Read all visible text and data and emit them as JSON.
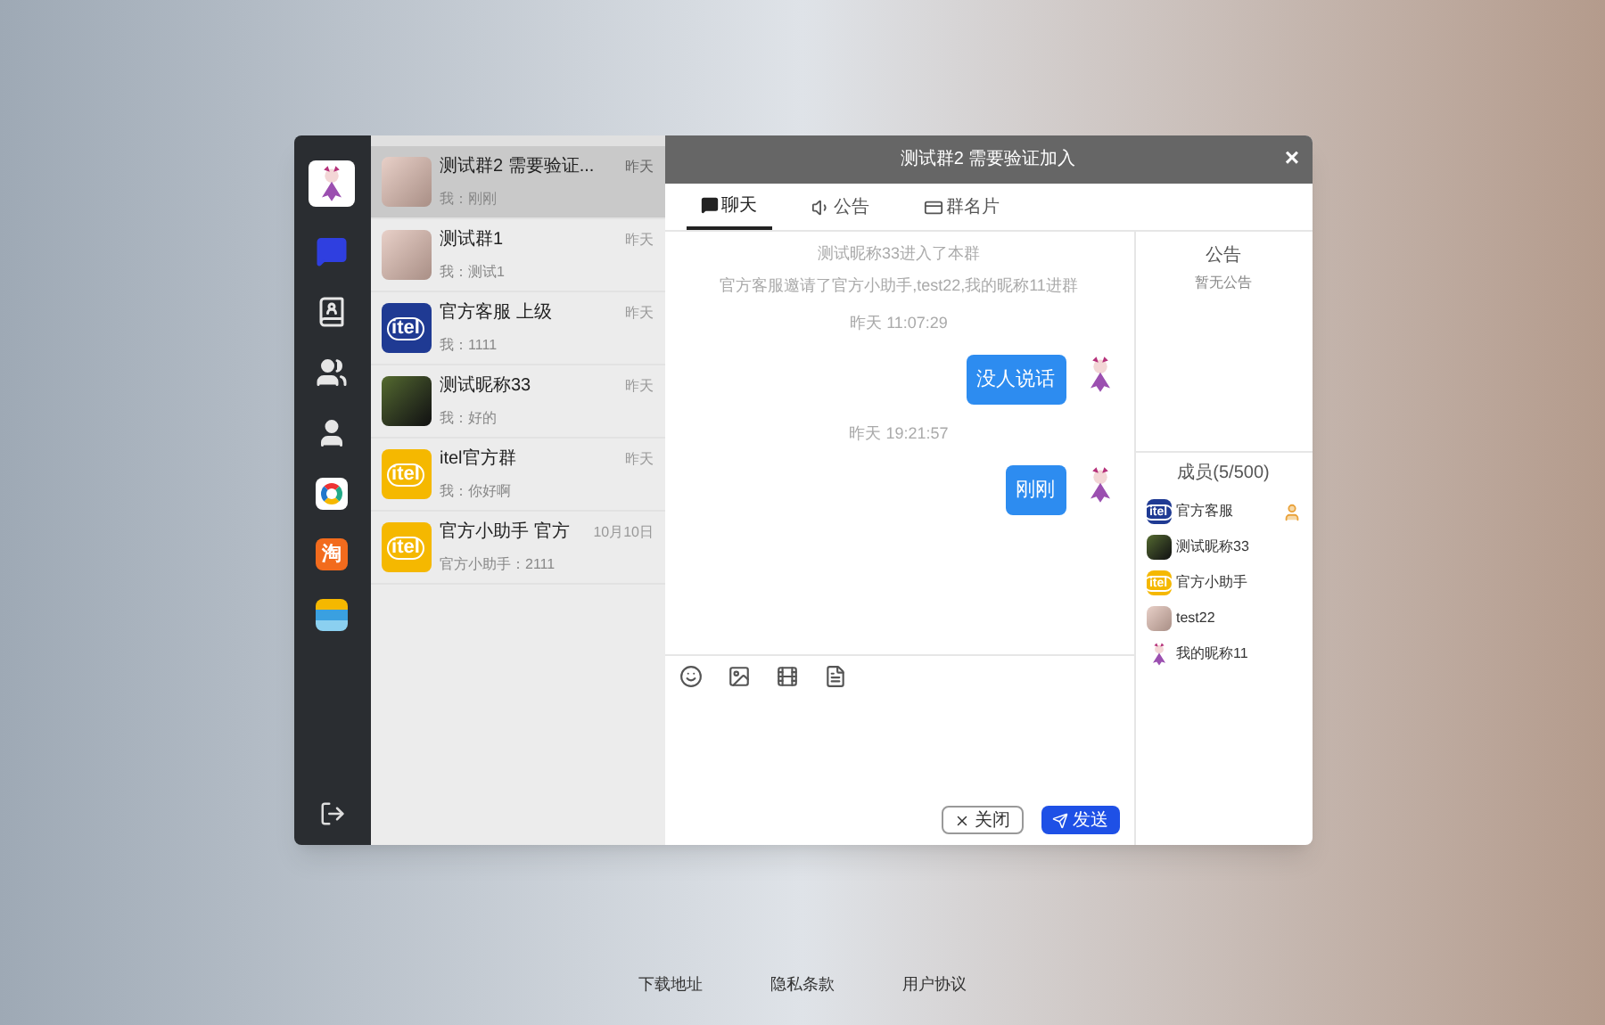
{
  "nav": {
    "items": [
      {
        "kind": "chat",
        "selected": true
      },
      {
        "kind": "contacts",
        "selected": false
      },
      {
        "kind": "groups",
        "selected": false
      },
      {
        "kind": "user",
        "selected": false
      },
      {
        "kind": "app-ring",
        "selected": false
      },
      {
        "kind": "app-tao",
        "selected": false
      },
      {
        "kind": "app-card",
        "selected": false
      }
    ],
    "tao_label": "淘"
  },
  "conversations": [
    {
      "name": "测试群2 需要验证...",
      "preview": "我：刚刚",
      "time": "昨天",
      "selected": true,
      "avatar": {
        "kind": "photo"
      }
    },
    {
      "name": "测试群1",
      "preview": "我：测试1",
      "time": "昨天",
      "selected": false,
      "avatar": {
        "kind": "photo"
      }
    },
    {
      "name": "官方客服 上级",
      "preview": "我：1111",
      "time": "昨天",
      "selected": false,
      "avatar": {
        "kind": "logo",
        "text": "itel",
        "color": "#1f3a93"
      }
    },
    {
      "name": "测试昵称33",
      "preview": "我：好的",
      "time": "昨天",
      "selected": false,
      "avatar": {
        "kind": "dark-photo"
      }
    },
    {
      "name": "itel官方群",
      "preview": "我：你好啊",
      "time": "昨天",
      "selected": false,
      "avatar": {
        "kind": "logo",
        "text": "itel",
        "color": "#f5b800"
      }
    },
    {
      "name": "官方小助手 官方",
      "preview": "官方小助手：2111",
      "time": "10月10日",
      "selected": false,
      "avatar": {
        "kind": "logo",
        "text": "itel",
        "color": "#f5b800"
      }
    }
  ],
  "chat": {
    "title": "测试群2 需要验证加入",
    "close": "×",
    "tabs": [
      {
        "label": "聊天",
        "selected": true
      },
      {
        "label": "公告",
        "selected": false
      },
      {
        "label": "群名片",
        "selected": false
      }
    ],
    "messages": [
      {
        "kind": "system",
        "text": "测试昵称33进入了本群"
      },
      {
        "kind": "system",
        "text": "官方客服邀请了官方小助手,test22,我的昵称11进群"
      },
      {
        "kind": "time",
        "text": "昨天 11:07:29"
      },
      {
        "kind": "mine",
        "text": "没人说话"
      },
      {
        "kind": "time",
        "text": "昨天 19:21:57"
      },
      {
        "kind": "mine",
        "text": "刚刚"
      }
    ],
    "buttons": [
      {
        "label": "关闭",
        "kind": "close"
      },
      {
        "label": "发送",
        "kind": "send"
      }
    ]
  },
  "side": {
    "notice_title": "公告",
    "notice_text": "暂无公告",
    "members_title": "成员(5/500)",
    "members": [
      {
        "name": "官方客服",
        "owner": true,
        "avatar": {
          "kind": "logo",
          "text": "itel",
          "color": "#1f3a93"
        }
      },
      {
        "name": "测试昵称33",
        "owner": false,
        "avatar": {
          "kind": "dark-photo"
        }
      },
      {
        "name": "官方小助手",
        "owner": false,
        "avatar": {
          "kind": "logo",
          "text": "itel",
          "color": "#f5b800"
        }
      },
      {
        "name": "test22",
        "owner": false,
        "avatar": {
          "kind": "photo"
        }
      },
      {
        "name": "我的昵称11",
        "owner": false,
        "avatar": {
          "kind": "figure"
        }
      }
    ]
  },
  "footer": {
    "links": [
      "下载地址",
      "隐私条款",
      "用户协议"
    ]
  }
}
